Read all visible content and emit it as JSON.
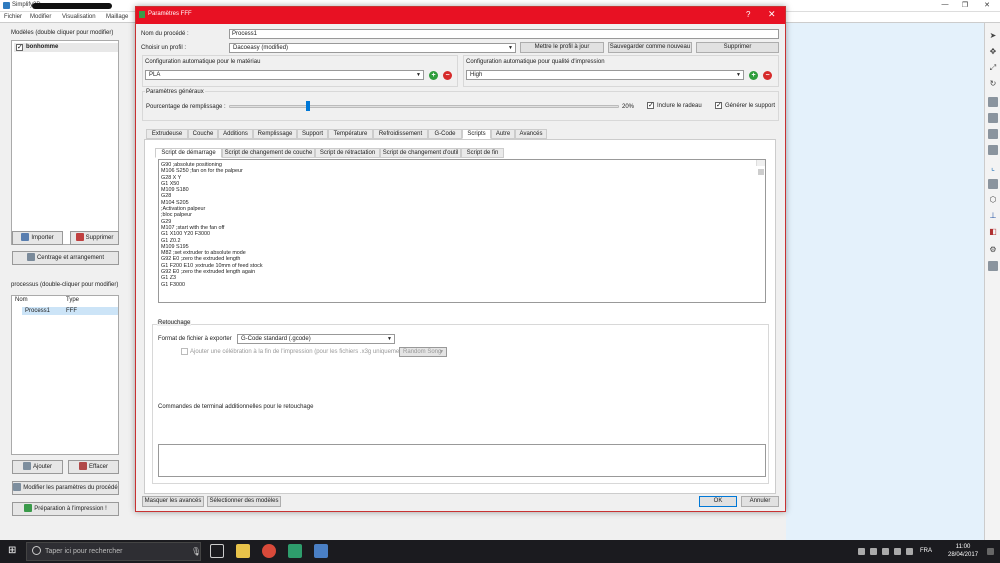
{
  "app": {
    "title": "Simplify3D",
    "menu": [
      "Fichier",
      "Modifier",
      "Visualisation",
      "Maillage"
    ],
    "window_controls": {
      "minimize": "—",
      "restore": "❐",
      "close": "✕"
    }
  },
  "left_panel": {
    "models_title": "Modèles (double cliquer pour modifier)",
    "models": [
      {
        "name": "bonhomme",
        "checked": true
      }
    ],
    "import_label": "Importer",
    "delete_label": "Supprimer",
    "center_label": "Centrage et arrangement",
    "process_title": "processus (double-cliquer pour modifier)",
    "process_headers": [
      "Nom",
      "Type"
    ],
    "process_rows": [
      {
        "name": "Process1",
        "type": "FFF"
      }
    ],
    "add_label": "Ajouter",
    "erase_label": "Effacer",
    "modify_label": "Modifier les paramètres du procédé",
    "prepare_label": "Préparation à l'impression !"
  },
  "dialog": {
    "title": "Paramètres FFF",
    "help": "?",
    "close": "✕",
    "process_name_label": "Nom du procédé :",
    "process_name_value": "Process1",
    "profile_label": "Choisir un profil :",
    "profile_value": "Dacoeasy (modified)",
    "update_profile_label": "Mettre le profil à jour",
    "save_new_label": "Sauvegarder comme nouveau",
    "delete_profile_label": "Supprimer",
    "material_label": "Configuration automatique pour le matériau",
    "material_value": "PLA",
    "quality_label": "Configuration automatique pour qualité d'impression",
    "quality_value": "High",
    "general_title": "Paramètres généraux",
    "infill_label": "Pourcentage de remplissage :",
    "infill_value": "20%",
    "infill_fraction": 0.2,
    "raft_label": "Inclure le radeau",
    "raft_checked": true,
    "support_label": "Générer le support",
    "support_checked": true,
    "tabs": [
      "Extrudeuse",
      "Couche",
      "Additions",
      "Remplissage",
      "Support",
      "Température",
      "Refroidissement",
      "G-Code",
      "Scripts",
      "Autre",
      "Avancés"
    ],
    "active_tab": "Scripts",
    "subtabs": [
      "Script de démarrage",
      "Script de changement de couche",
      "Script de rétractation",
      "Script de changement d'outil",
      "Script de fin"
    ],
    "active_subtab": "Script de démarrage",
    "script_lines": [
      "G90 ;absolute positioning",
      "M106 S250 ;fan on for the palpeur",
      "G28 X Y",
      "G1 X50",
      "M109 S180",
      "G28",
      "M104 S205",
      ";Activation palpeur",
      ";bloc palpeur",
      "G29",
      "M107 ;start with the fan off",
      "G1 X100 Y20 F3000",
      "G1 Z0.2",
      "M109 S195",
      "M82 ;set extruder to absolute mode",
      "G92 E0 ;zero the extruded length",
      "G1 F200 E10 ;extrude 10mm of feed stock",
      "G92 E0 ;zero the extruded length again",
      "G1 Z3",
      "G1 F3000"
    ],
    "retouch_title": "Retouchage",
    "export_format_label": "Format de fichier à exporter",
    "export_format_value": "G-Code standard (.gcode)",
    "celebrate_label": "Ajouter une célébration à la fin de l'impression (pour les fichiers .x3g uniquement)",
    "celebrate_value": "Random Song",
    "terminal_label": "Commandes de terminal additionnelles pour le retouchage",
    "hide_advanced_label": "Masquer les avancés",
    "select_models_label": "Sélectionner des modèles",
    "ok_label": "OK",
    "cancel_label": "Annuler"
  },
  "taskbar": {
    "search_placeholder": "Taper ici pour rechercher",
    "lang": "FRA",
    "time": "11:00",
    "date": "28/04/2017"
  },
  "colors": {
    "dialog_titlebar": "#e81123",
    "accent": "#0078d7",
    "viewport": "#e4f1fb",
    "add_green": "#2e9d3c",
    "delete_red": "#d62b2b"
  }
}
